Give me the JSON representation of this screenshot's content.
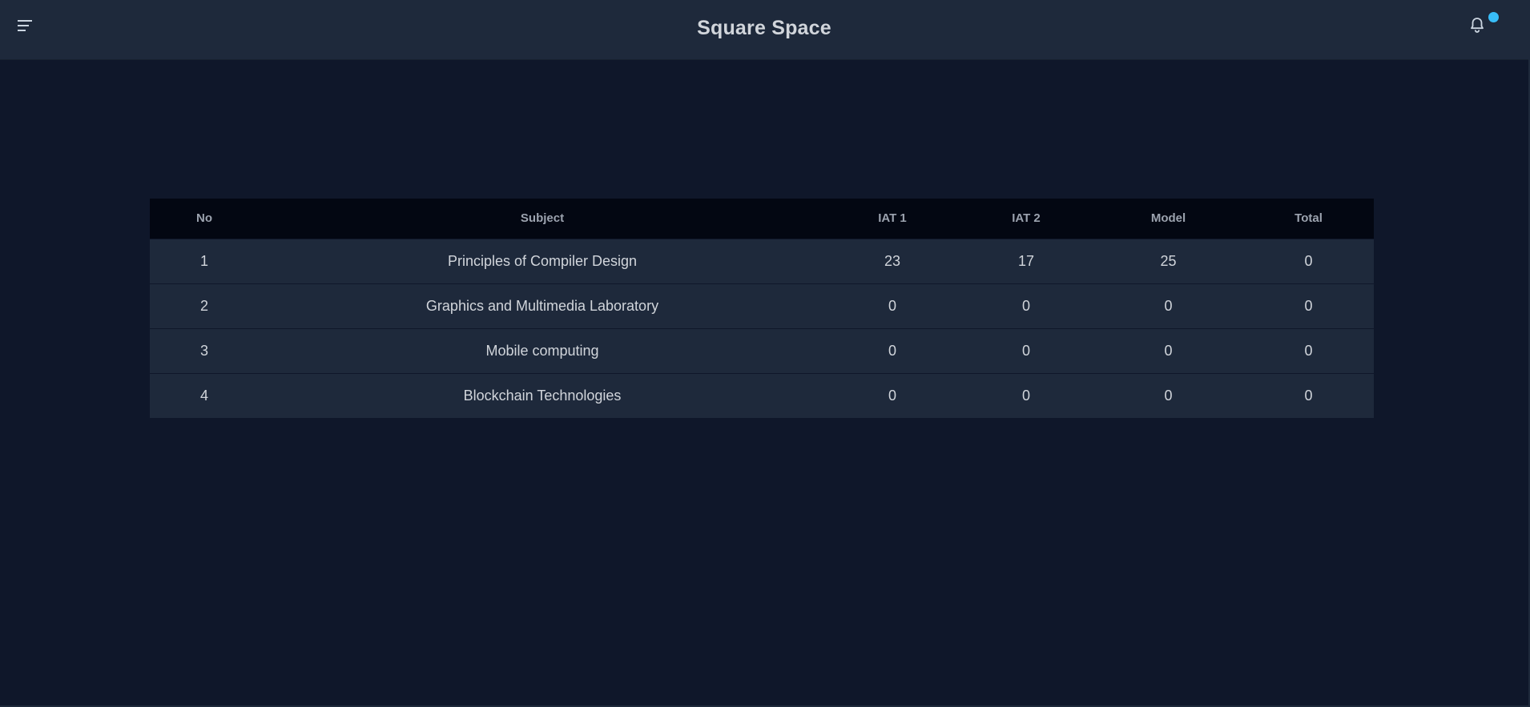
{
  "header": {
    "title": "Square Space",
    "menu_icon": "menu-icon",
    "notification_icon": "bell-icon",
    "notification_dot_color": "#38bdf8"
  },
  "table": {
    "columns": [
      "No",
      "Subject",
      "IAT 1",
      "IAT 2",
      "Model",
      "Total"
    ],
    "rows": [
      [
        "1",
        "Principles of Compiler Design",
        "23",
        "17",
        "25",
        "0"
      ],
      [
        "2",
        "Graphics and Multimedia Laboratory",
        "0",
        "0",
        "0",
        "0"
      ],
      [
        "3",
        "Mobile computing",
        "0",
        "0",
        "0",
        "0"
      ],
      [
        "4",
        "Blockchain Technologies",
        "0",
        "0",
        "0",
        "0"
      ]
    ]
  }
}
